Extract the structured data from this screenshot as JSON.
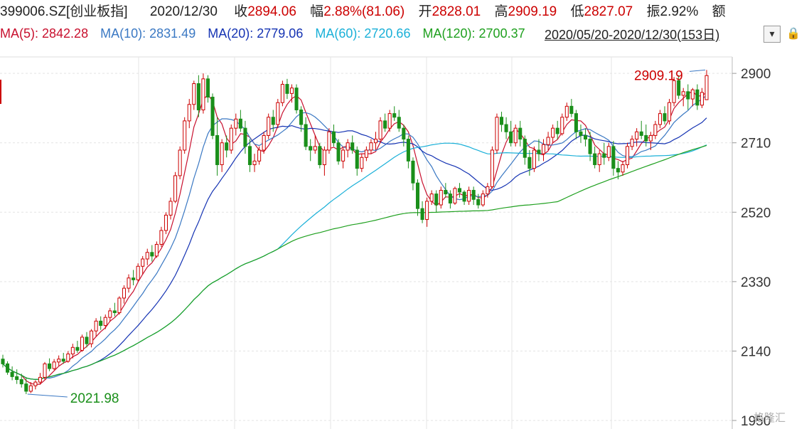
{
  "header": {
    "code": "399006.SZ[创业板指]",
    "date": "2020/12/30",
    "close_label": "收",
    "close": "2894.06",
    "change_label": "幅",
    "change": "2.88%(81.06)",
    "open_label": "开",
    "open": "2828.01",
    "high_label": "高",
    "high": "2909.19",
    "low_label": "低",
    "low": "2827.07",
    "amp_label": "振",
    "amp": "2.92%",
    "amount_label": "额"
  },
  "ma": [
    {
      "label": "MA(5):",
      "value": "2842.28",
      "color": "#c8102e"
    },
    {
      "label": "MA(10):",
      "value": "2831.49",
      "color": "#3a78c3"
    },
    {
      "label": "MA(20):",
      "value": "2779.06",
      "color": "#1533b3"
    },
    {
      "label": "MA(60):",
      "value": "2720.66",
      "color": "#1ab0d8"
    },
    {
      "label": "MA(120):",
      "value": "2700.37",
      "color": "#1fa01f"
    }
  ],
  "range": "2020/05/20-2020/12/30(153日)",
  "range_button_icon": "chevron-down-icon",
  "lock_icon": "lock-icon",
  "watermark": "格隆汇",
  "chart_data": {
    "type": "candlestick",
    "ylim": [
      1950,
      2910
    ],
    "y_ticks": [
      "2900",
      "2710",
      "2520",
      "2330",
      "2140",
      "1950"
    ],
    "annotations": [
      {
        "text": "2909.19",
        "value": 2909.19,
        "kind": "high"
      },
      {
        "text": "2021.98",
        "value": 2021.98,
        "kind": "low"
      }
    ],
    "colors": {
      "up": "#cc0000",
      "down": "#1a8f1a"
    },
    "ohlc": [
      [
        2118,
        2130,
        2095,
        2105
      ],
      [
        2105,
        2112,
        2075,
        2082
      ],
      [
        2082,
        2098,
        2060,
        2070
      ],
      [
        2070,
        2090,
        2050,
        2062
      ],
      [
        2062,
        2078,
        2040,
        2050
      ],
      [
        2050,
        2068,
        2022,
        2030
      ],
      [
        2030,
        2055,
        2025,
        2045
      ],
      [
        2045,
        2060,
        2035,
        2055
      ],
      [
        2055,
        2080,
        2048,
        2068
      ],
      [
        2068,
        2110,
        2062,
        2105
      ],
      [
        2105,
        2120,
        2085,
        2092
      ],
      [
        2092,
        2118,
        2088,
        2110
      ],
      [
        2110,
        2128,
        2100,
        2118
      ],
      [
        2118,
        2135,
        2105,
        2112
      ],
      [
        2112,
        2140,
        2108,
        2132
      ],
      [
        2132,
        2160,
        2120,
        2150
      ],
      [
        2150,
        2168,
        2135,
        2142
      ],
      [
        2142,
        2185,
        2138,
        2178
      ],
      [
        2178,
        2192,
        2150,
        2160
      ],
      [
        2160,
        2200,
        2150,
        2195
      ],
      [
        2195,
        2230,
        2180,
        2222
      ],
      [
        2222,
        2235,
        2198,
        2210
      ],
      [
        2210,
        2240,
        2200,
        2232
      ],
      [
        2232,
        2258,
        2220,
        2250
      ],
      [
        2250,
        2272,
        2235,
        2245
      ],
      [
        2245,
        2290,
        2240,
        2285
      ],
      [
        2285,
        2320,
        2270,
        2312
      ],
      [
        2312,
        2350,
        2300,
        2340
      ],
      [
        2340,
        2362,
        2320,
        2335
      ],
      [
        2335,
        2380,
        2330,
        2372
      ],
      [
        2372,
        2400,
        2350,
        2392
      ],
      [
        2392,
        2420,
        2375,
        2410
      ],
      [
        2410,
        2430,
        2385,
        2400
      ],
      [
        2400,
        2440,
        2395,
        2432
      ],
      [
        2432,
        2480,
        2425,
        2470
      ],
      [
        2470,
        2520,
        2460,
        2512
      ],
      [
        2512,
        2560,
        2500,
        2550
      ],
      [
        2550,
        2630,
        2545,
        2620
      ],
      [
        2620,
        2700,
        2610,
        2690
      ],
      [
        2690,
        2780,
        2680,
        2770
      ],
      [
        2770,
        2830,
        2750,
        2815
      ],
      [
        2815,
        2880,
        2800,
        2872
      ],
      [
        2872,
        2895,
        2780,
        2800
      ],
      [
        2800,
        2900,
        2790,
        2885
      ],
      [
        2885,
        2895,
        2820,
        2835
      ],
      [
        2835,
        2845,
        2720,
        2730
      ],
      [
        2730,
        2780,
        2620,
        2650
      ],
      [
        2650,
        2720,
        2630,
        2710
      ],
      [
        2710,
        2730,
        2670,
        2690
      ],
      [
        2690,
        2760,
        2680,
        2750
      ],
      [
        2750,
        2790,
        2730,
        2775
      ],
      [
        2775,
        2800,
        2740,
        2750
      ],
      [
        2750,
        2770,
        2680,
        2700
      ],
      [
        2700,
        2720,
        2630,
        2650
      ],
      [
        2650,
        2680,
        2630,
        2660
      ],
      [
        2660,
        2700,
        2650,
        2690
      ],
      [
        2690,
        2740,
        2680,
        2730
      ],
      [
        2730,
        2790,
        2720,
        2780
      ],
      [
        2780,
        2800,
        2740,
        2760
      ],
      [
        2760,
        2830,
        2750,
        2820
      ],
      [
        2820,
        2880,
        2810,
        2870
      ],
      [
        2870,
        2885,
        2830,
        2845
      ],
      [
        2845,
        2870,
        2820,
        2860
      ],
      [
        2860,
        2870,
        2790,
        2800
      ],
      [
        2800,
        2810,
        2740,
        2760
      ],
      [
        2760,
        2780,
        2690,
        2700
      ],
      [
        2700,
        2720,
        2660,
        2690
      ],
      [
        2690,
        2730,
        2680,
        2700
      ],
      [
        2700,
        2710,
        2640,
        2650
      ],
      [
        2650,
        2700,
        2620,
        2690
      ],
      [
        2690,
        2750,
        2680,
        2740
      ],
      [
        2740,
        2760,
        2700,
        2710
      ],
      [
        2710,
        2720,
        2650,
        2660
      ],
      [
        2660,
        2700,
        2640,
        2690
      ],
      [
        2690,
        2720,
        2670,
        2710
      ],
      [
        2710,
        2730,
        2680,
        2690
      ],
      [
        2690,
        2700,
        2620,
        2640
      ],
      [
        2640,
        2680,
        2630,
        2670
      ],
      [
        2670,
        2700,
        2660,
        2690
      ],
      [
        2690,
        2720,
        2680,
        2710
      ],
      [
        2710,
        2740,
        2690,
        2720
      ],
      [
        2720,
        2780,
        2710,
        2770
      ],
      [
        2770,
        2790,
        2740,
        2750
      ],
      [
        2750,
        2800,
        2740,
        2790
      ],
      [
        2790,
        2810,
        2770,
        2780
      ],
      [
        2780,
        2800,
        2740,
        2750
      ],
      [
        2750,
        2760,
        2700,
        2720
      ],
      [
        2720,
        2730,
        2640,
        2660
      ],
      [
        2660,
        2670,
        2580,
        2600
      ],
      [
        2600,
        2610,
        2510,
        2530
      ],
      [
        2530,
        2550,
        2490,
        2500
      ],
      [
        2500,
        2560,
        2480,
        2550
      ],
      [
        2550,
        2580,
        2540,
        2570
      ],
      [
        2570,
        2580,
        2520,
        2540
      ],
      [
        2540,
        2590,
        2530,
        2580
      ],
      [
        2580,
        2600,
        2560,
        2570
      ],
      [
        2570,
        2580,
        2530,
        2545
      ],
      [
        2545,
        2590,
        2540,
        2585
      ],
      [
        2585,
        2600,
        2560,
        2575
      ],
      [
        2575,
        2580,
        2540,
        2550
      ],
      [
        2550,
        2590,
        2540,
        2580
      ],
      [
        2580,
        2590,
        2540,
        2555
      ],
      [
        2555,
        2570,
        2530,
        2540
      ],
      [
        2540,
        2580,
        2535,
        2570
      ],
      [
        2570,
        2600,
        2560,
        2590
      ],
      [
        2590,
        2700,
        2585,
        2690
      ],
      [
        2690,
        2790,
        2680,
        2780
      ],
      [
        2780,
        2795,
        2740,
        2760
      ],
      [
        2760,
        2780,
        2720,
        2740
      ],
      [
        2740,
        2770,
        2700,
        2710
      ],
      [
        2710,
        2760,
        2700,
        2750
      ],
      [
        2750,
        2770,
        2700,
        2720
      ],
      [
        2720,
        2730,
        2650,
        2670
      ],
      [
        2670,
        2690,
        2620,
        2640
      ],
      [
        2640,
        2700,
        2630,
        2690
      ],
      [
        2690,
        2720,
        2660,
        2680
      ],
      [
        2680,
        2720,
        2660,
        2705
      ],
      [
        2705,
        2740,
        2690,
        2725
      ],
      [
        2725,
        2760,
        2710,
        2750
      ],
      [
        2750,
        2770,
        2720,
        2735
      ],
      [
        2735,
        2790,
        2730,
        2780
      ],
      [
        2780,
        2820,
        2770,
        2810
      ],
      [
        2810,
        2830,
        2780,
        2790
      ],
      [
        2790,
        2800,
        2720,
        2740
      ],
      [
        2740,
        2760,
        2710,
        2730
      ],
      [
        2730,
        2750,
        2700,
        2720
      ],
      [
        2720,
        2740,
        2660,
        2680
      ],
      [
        2680,
        2700,
        2640,
        2650
      ],
      [
        2650,
        2690,
        2630,
        2680
      ],
      [
        2680,
        2710,
        2650,
        2670
      ],
      [
        2670,
        2710,
        2660,
        2700
      ],
      [
        2700,
        2715,
        2620,
        2640
      ],
      [
        2640,
        2660,
        2610,
        2630
      ],
      [
        2630,
        2660,
        2620,
        2650
      ],
      [
        2650,
        2710,
        2640,
        2700
      ],
      [
        2700,
        2730,
        2690,
        2720
      ],
      [
        2720,
        2750,
        2700,
        2740
      ],
      [
        2740,
        2770,
        2720,
        2730
      ],
      [
        2730,
        2760,
        2700,
        2715
      ],
      [
        2715,
        2740,
        2690,
        2730
      ],
      [
        2730,
        2770,
        2720,
        2760
      ],
      [
        2760,
        2800,
        2750,
        2790
      ],
      [
        2790,
        2810,
        2760,
        2770
      ],
      [
        2770,
        2830,
        2760,
        2820
      ],
      [
        2820,
        2890,
        2810,
        2880
      ],
      [
        2880,
        2895,
        2830,
        2840
      ],
      [
        2840,
        2860,
        2810,
        2850
      ],
      [
        2850,
        2870,
        2800,
        2830
      ],
      [
        2830,
        2860,
        2810,
        2855
      ],
      [
        2855,
        2870,
        2800,
        2813
      ],
      [
        2813,
        2860,
        2805,
        2848
      ],
      [
        2828,
        2909.19,
        2827.07,
        2894.06
      ]
    ],
    "ma_lines": [
      {
        "name": "MA(5)",
        "color": "#c8102e",
        "period": 5
      },
      {
        "name": "MA(10)",
        "color": "#3a78c3",
        "period": 10
      },
      {
        "name": "MA(20)",
        "color": "#1533b3",
        "period": 20
      },
      {
        "name": "MA(60)",
        "color": "#1ab0d8",
        "period": 60
      },
      {
        "name": "MA(120)",
        "color": "#1fa01f",
        "period": 120
      }
    ]
  }
}
